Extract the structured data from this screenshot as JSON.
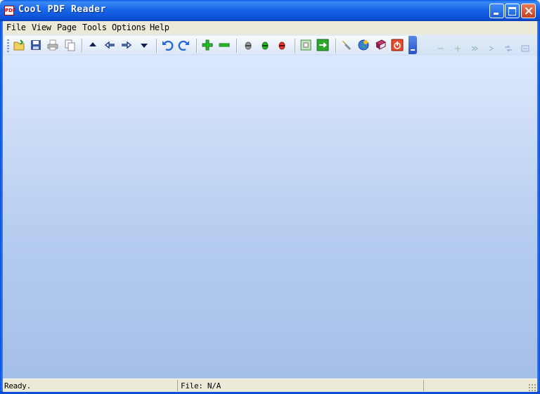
{
  "window": {
    "title": "Cool PDF Reader",
    "icon_text": "PDF"
  },
  "menu": {
    "items": [
      "File",
      "View",
      "Page",
      "Tools",
      "Options",
      "Help"
    ]
  },
  "toolbar": {
    "buttons": [
      "open-icon",
      "save-icon",
      "print-icon",
      "copy-icon",
      "first-page-icon",
      "previous-page-icon",
      "next-page-icon",
      "last-page-icon",
      "rotate-left-icon",
      "rotate-right-icon",
      "zoom-in-icon",
      "zoom-out-icon",
      "fit-width-icon",
      "fit-page-icon",
      "actual-size-icon",
      "convert-icon",
      "go-to-page-icon",
      "settings-icon",
      "web-icon",
      "help-book-icon",
      "exit-icon"
    ]
  },
  "status": {
    "message": "Ready.",
    "file": "File: N/A"
  },
  "colors": {
    "title_bar": "#0a4fd6",
    "client_top": "#dce8fc",
    "client_bottom": "#a4bfe8",
    "toolbar_accent": "#2a52c8"
  }
}
